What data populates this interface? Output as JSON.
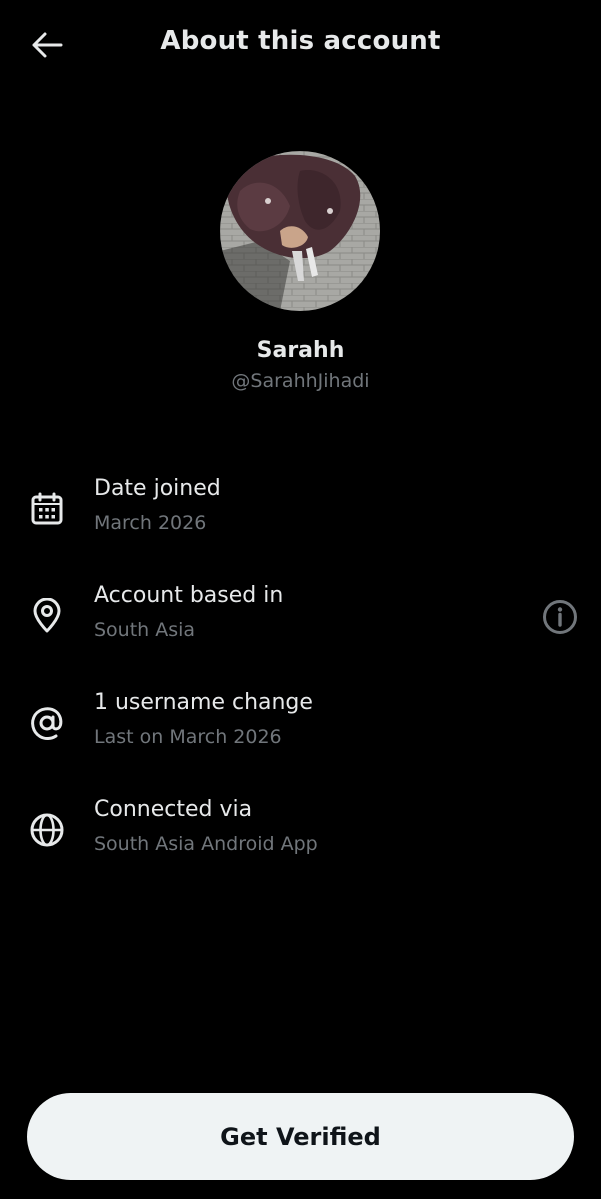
{
  "header": {
    "title": "About this account",
    "back_icon": "arrow-left-icon"
  },
  "profile": {
    "display_name": "Sarahh",
    "handle": "@SarahhJihadi",
    "avatar": "profile-photo"
  },
  "details": [
    {
      "icon": "calendar-icon",
      "title": "Date joined",
      "subtitle": "March 2026"
    },
    {
      "icon": "location-pin-icon",
      "title": "Account based in",
      "subtitle": "South Asia",
      "action_icon": "info-icon"
    },
    {
      "icon": "at-sign-icon",
      "title": "1 username change",
      "subtitle": "Last on March 2026"
    },
    {
      "icon": "globe-icon",
      "title": "Connected via",
      "subtitle": "South Asia Android App"
    }
  ],
  "cta": {
    "label": "Get Verified"
  },
  "colors": {
    "background": "#000000",
    "primary_text": "#e7e9ea",
    "secondary_text": "#71767b",
    "button_bg": "#eff3f4",
    "button_text": "#0f1419"
  }
}
